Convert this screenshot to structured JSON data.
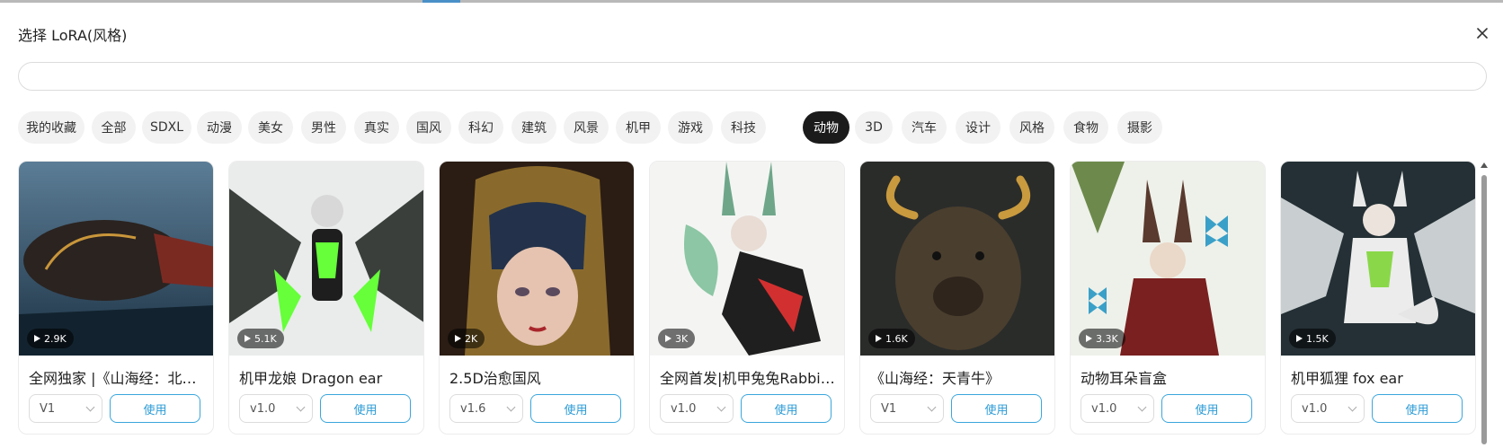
{
  "dialog": {
    "title": "选择 LoRA(风格)",
    "search": {
      "value": "",
      "placeholder": ""
    }
  },
  "categories": [
    {
      "label": "我的收藏",
      "active": false
    },
    {
      "label": "全部",
      "active": false
    },
    {
      "label": "SDXL",
      "active": false
    },
    {
      "label": "动漫",
      "active": false
    },
    {
      "label": "美女",
      "active": false
    },
    {
      "label": "男性",
      "active": false
    },
    {
      "label": "真实",
      "active": false
    },
    {
      "label": "国风",
      "active": false
    },
    {
      "label": "科幻",
      "active": false
    },
    {
      "label": "建筑",
      "active": false
    },
    {
      "label": "风景",
      "active": false
    },
    {
      "label": "机甲",
      "active": false
    },
    {
      "label": "游戏",
      "active": false
    },
    {
      "label": "科技",
      "active": false
    },
    {
      "label": "动物",
      "active": true
    },
    {
      "label": "3D",
      "active": false
    },
    {
      "label": "汽车",
      "active": false
    },
    {
      "label": "设计",
      "active": false
    },
    {
      "label": "风格",
      "active": false
    },
    {
      "label": "食物",
      "active": false
    },
    {
      "label": "摄影",
      "active": false
    }
  ],
  "cards": [
    {
      "name": "全网独家 |《山海经：北冥鲲》",
      "views": "2.9K",
      "version": "V1",
      "use_label": "使用"
    },
    {
      "name": "机甲龙娘 Dragon ear",
      "views": "5.1K",
      "version": "v1.0",
      "use_label": "使用"
    },
    {
      "name": "2.5D治愈国风",
      "views": "2K",
      "version": "v1.6",
      "use_label": "使用"
    },
    {
      "name": "全网首发|机甲兔兔Rabbit ear",
      "views": "3K",
      "version": "v1.0",
      "use_label": "使用"
    },
    {
      "name": "《山海经：天青牛》",
      "views": "1.6K",
      "version": "V1",
      "use_label": "使用"
    },
    {
      "name": "动物耳朵盲盒",
      "views": "3.3K",
      "version": "v1.0",
      "use_label": "使用"
    },
    {
      "name": "机甲狐狸 fox ear",
      "views": "1.5K",
      "version": "v1.0",
      "use_label": "使用"
    }
  ],
  "icons": {
    "close": "close-icon",
    "play": "play-icon",
    "chevron": "chevron-down-icon"
  },
  "colors": {
    "accent": "#2b9bd6",
    "active_chip": "#1b1b1b",
    "chip": "#f2f2f2"
  }
}
